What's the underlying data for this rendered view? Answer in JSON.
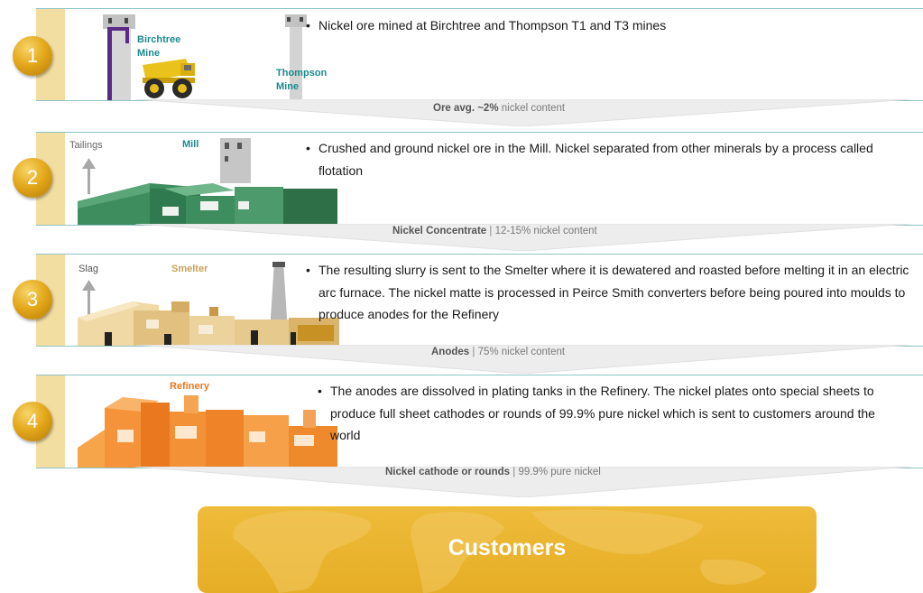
{
  "stages": [
    {
      "number": "1",
      "description": "Nickel ore mined at Birchtree and Thompson T1 and T3 mines",
      "labels": {
        "birchtree": "Birchtree Mine",
        "thompson": "Thompson Mine"
      }
    },
    {
      "number": "2",
      "description": "Crushed and ground nickel ore in the Mill. Nickel separated from other minerals by a process called flotation",
      "labels": {
        "tailings": "Tailings",
        "mill": "Mill"
      }
    },
    {
      "number": "3",
      "description": "The resulting slurry is sent to the Smelter where it is dewatered and roasted before melting it in an electric arc furnace. The nickel matte is processed in Peirce Smith converters before being poured into moulds to produce anodes for the Refinery",
      "labels": {
        "slag": "Slag",
        "smelter": "Smelter"
      }
    },
    {
      "number": "4",
      "description": "The anodes are dissolved in plating tanks in the Refinery. The nickel plates onto special sheets to produce full sheet cathodes or rounds of 99.9% pure nickel which is sent to customers around the world",
      "labels": {
        "refinery": "Refinery"
      }
    }
  ],
  "transitions": [
    {
      "product": "Ore avg. ~2%",
      "detail": "nickel content"
    },
    {
      "product": "Nickel Concentrate",
      "detail": "12-15% nickel content"
    },
    {
      "product": "Anodes",
      "detail": "75% nickel content"
    },
    {
      "product": "Nickel cathode or rounds",
      "detail": "99.9% pure nickel"
    }
  ],
  "customers": {
    "label": "Customers"
  },
  "colors": {
    "accent_gold": "#e5a91c",
    "band": "#f3dea2",
    "mill_green": "#3a8a5c",
    "smelter_tan": "#e6c98c",
    "refinery_orange": "#f08a24",
    "label_teal": "#1c8a8f"
  },
  "icons": [
    "mine-headframe-icon",
    "haul-truck-icon",
    "mill-building-icon",
    "smelter-building-icon",
    "refinery-building-icon",
    "up-arrow-icon",
    "world-map-icon"
  ]
}
